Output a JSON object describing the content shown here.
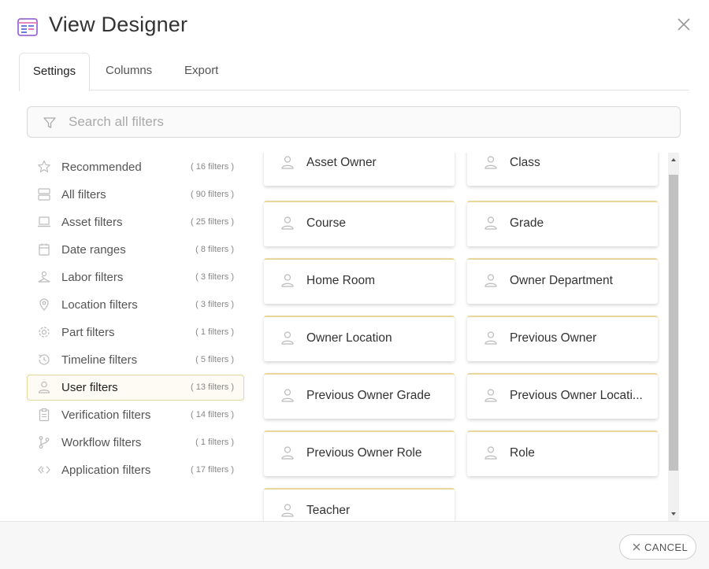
{
  "window": {
    "title": "View Designer"
  },
  "tabs": [
    {
      "label": "Settings",
      "active": true
    },
    {
      "label": "Columns",
      "active": false
    },
    {
      "label": "Export",
      "active": false
    }
  ],
  "search": {
    "placeholder": "Search all filters",
    "value": ""
  },
  "sidebar": {
    "items": [
      {
        "label": "Recommended",
        "count": "( 16 filters )",
        "icon": "star-icon"
      },
      {
        "label": "All filters",
        "count": "( 90 filters )",
        "icon": "server-icon"
      },
      {
        "label": "Asset filters",
        "count": "( 25 filters )",
        "icon": "laptop-icon"
      },
      {
        "label": "Date ranges",
        "count": "( 8 filters )",
        "icon": "calendar-icon"
      },
      {
        "label": "Labor filters",
        "count": "( 3 filters )",
        "icon": "worker-icon"
      },
      {
        "label": "Location filters",
        "count": "( 3 filters )",
        "icon": "map-pin-icon"
      },
      {
        "label": "Part filters",
        "count": "( 1 filters )",
        "icon": "gear-icon"
      },
      {
        "label": "Timeline filters",
        "count": "( 5 filters )",
        "icon": "history-icon"
      },
      {
        "label": "User filters",
        "count": "( 13 filters )",
        "icon": "user-icon",
        "active": true
      },
      {
        "label": "Verification filters",
        "count": "( 14 filters )",
        "icon": "clipboard-icon"
      },
      {
        "label": "Workflow filters",
        "count": "( 1 filters )",
        "icon": "branch-icon"
      },
      {
        "label": "Application filters",
        "count": "( 17 filters )",
        "icon": "code-icon"
      }
    ]
  },
  "filters": [
    {
      "label": "Asset Owner"
    },
    {
      "label": "Class"
    },
    {
      "label": "Course"
    },
    {
      "label": "Grade"
    },
    {
      "label": "Home Room"
    },
    {
      "label": "Owner Department"
    },
    {
      "label": "Owner Location"
    },
    {
      "label": "Previous Owner"
    },
    {
      "label": "Previous Owner Grade"
    },
    {
      "label": "Previous Owner Locati..."
    },
    {
      "label": "Previous Owner Role"
    },
    {
      "label": "Role"
    },
    {
      "label": "Teacher"
    }
  ],
  "footer": {
    "cancel_label": "CANCEL"
  },
  "colors": {
    "accent": "#e8d69a",
    "app_icon": "#c678dd"
  }
}
